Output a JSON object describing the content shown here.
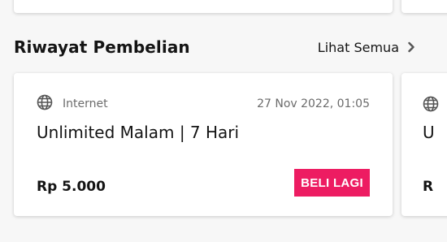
{
  "section": {
    "title": "Riwayat Pembelian",
    "see_all_label": "Lihat Semua"
  },
  "purchase": {
    "category": "Internet",
    "timestamp": "27 Nov 2022, 01:05",
    "product": "Unlimited Malam | 7 Hari",
    "price": "Rp 5.000",
    "buy_again_label": "BELI LAGI"
  },
  "next_card_peek": {
    "product_initial": "U",
    "price_initial": "R"
  },
  "colors": {
    "accent": "#ed1c62",
    "text": "#141414",
    "muted": "#6b6b6b",
    "background": "#f7f7f7"
  }
}
